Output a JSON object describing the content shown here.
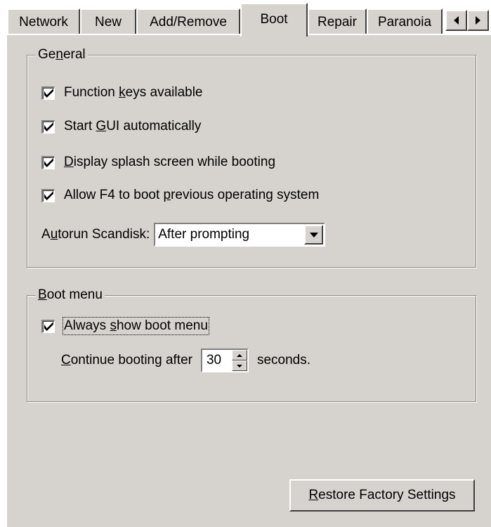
{
  "tabs": [
    {
      "label": "Network",
      "active": false
    },
    {
      "label": "New",
      "active": false
    },
    {
      "label": "Add/Remove",
      "active": false
    },
    {
      "label": "Boot",
      "active": true
    },
    {
      "label": "Repair",
      "active": false
    },
    {
      "label": "Paranoia",
      "active": false
    }
  ],
  "general": {
    "title": "General",
    "function_keys": {
      "before": "Function ",
      "mnemonic": "k",
      "after": "eys available",
      "checked": true
    },
    "start_gui": {
      "before": "Start ",
      "mnemonic": "G",
      "after": "UI automatically",
      "checked": true
    },
    "splash": {
      "before": "",
      "mnemonic": "D",
      "after": "isplay splash screen while booting",
      "checked": true
    },
    "allow_f4": {
      "before": "Allow F4 to boot ",
      "mnemonic": "p",
      "after": "revious operating system",
      "checked": true
    },
    "autorun": {
      "before": "A",
      "mnemonic": "u",
      "after": "torun Scandisk:",
      "value": "After prompting"
    }
  },
  "boot_menu": {
    "title": "Boot menu",
    "always_show": {
      "before": "Always ",
      "mnemonic": "s",
      "after": "how boot menu",
      "checked": true
    },
    "continue": {
      "before": "",
      "mnemonic": "C",
      "after": "ontinue booting after",
      "value": "30",
      "suffix": "seconds."
    }
  },
  "restore_button": {
    "before": "",
    "mnemonic": "R",
    "after": "estore Factory Settings"
  },
  "colors": {
    "face": "#d6d3ce",
    "highlight": "#ffffff",
    "shadow": "#808080",
    "dark_shadow": "#404040"
  }
}
